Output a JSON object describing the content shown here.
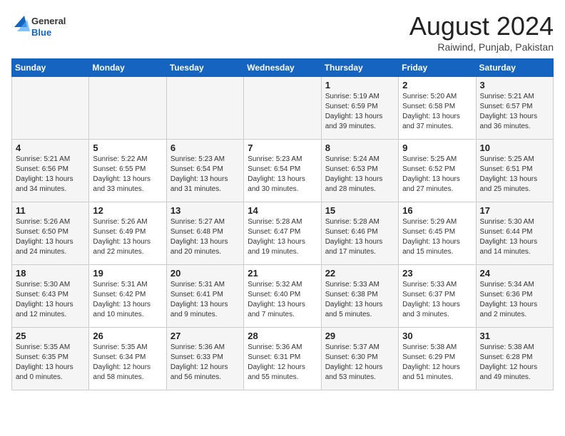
{
  "logo": {
    "general": "General",
    "blue": "Blue"
  },
  "title": "August 2024",
  "location": "Raiwind, Punjab, Pakistan",
  "days_of_week": [
    "Sunday",
    "Monday",
    "Tuesday",
    "Wednesday",
    "Thursday",
    "Friday",
    "Saturday"
  ],
  "weeks": [
    [
      {
        "day": "",
        "content": ""
      },
      {
        "day": "",
        "content": ""
      },
      {
        "day": "",
        "content": ""
      },
      {
        "day": "",
        "content": ""
      },
      {
        "day": "1",
        "content": "Sunrise: 5:19 AM\nSunset: 6:59 PM\nDaylight: 13 hours and 39 minutes."
      },
      {
        "day": "2",
        "content": "Sunrise: 5:20 AM\nSunset: 6:58 PM\nDaylight: 13 hours and 37 minutes."
      },
      {
        "day": "3",
        "content": "Sunrise: 5:21 AM\nSunset: 6:57 PM\nDaylight: 13 hours and 36 minutes."
      }
    ],
    [
      {
        "day": "4",
        "content": "Sunrise: 5:21 AM\nSunset: 6:56 PM\nDaylight: 13 hours and 34 minutes."
      },
      {
        "day": "5",
        "content": "Sunrise: 5:22 AM\nSunset: 6:55 PM\nDaylight: 13 hours and 33 minutes."
      },
      {
        "day": "6",
        "content": "Sunrise: 5:23 AM\nSunset: 6:54 PM\nDaylight: 13 hours and 31 minutes."
      },
      {
        "day": "7",
        "content": "Sunrise: 5:23 AM\nSunset: 6:54 PM\nDaylight: 13 hours and 30 minutes."
      },
      {
        "day": "8",
        "content": "Sunrise: 5:24 AM\nSunset: 6:53 PM\nDaylight: 13 hours and 28 minutes."
      },
      {
        "day": "9",
        "content": "Sunrise: 5:25 AM\nSunset: 6:52 PM\nDaylight: 13 hours and 27 minutes."
      },
      {
        "day": "10",
        "content": "Sunrise: 5:25 AM\nSunset: 6:51 PM\nDaylight: 13 hours and 25 minutes."
      }
    ],
    [
      {
        "day": "11",
        "content": "Sunrise: 5:26 AM\nSunset: 6:50 PM\nDaylight: 13 hours and 24 minutes."
      },
      {
        "day": "12",
        "content": "Sunrise: 5:26 AM\nSunset: 6:49 PM\nDaylight: 13 hours and 22 minutes."
      },
      {
        "day": "13",
        "content": "Sunrise: 5:27 AM\nSunset: 6:48 PM\nDaylight: 13 hours and 20 minutes."
      },
      {
        "day": "14",
        "content": "Sunrise: 5:28 AM\nSunset: 6:47 PM\nDaylight: 13 hours and 19 minutes."
      },
      {
        "day": "15",
        "content": "Sunrise: 5:28 AM\nSunset: 6:46 PM\nDaylight: 13 hours and 17 minutes."
      },
      {
        "day": "16",
        "content": "Sunrise: 5:29 AM\nSunset: 6:45 PM\nDaylight: 13 hours and 15 minutes."
      },
      {
        "day": "17",
        "content": "Sunrise: 5:30 AM\nSunset: 6:44 PM\nDaylight: 13 hours and 14 minutes."
      }
    ],
    [
      {
        "day": "18",
        "content": "Sunrise: 5:30 AM\nSunset: 6:43 PM\nDaylight: 13 hours and 12 minutes."
      },
      {
        "day": "19",
        "content": "Sunrise: 5:31 AM\nSunset: 6:42 PM\nDaylight: 13 hours and 10 minutes."
      },
      {
        "day": "20",
        "content": "Sunrise: 5:31 AM\nSunset: 6:41 PM\nDaylight: 13 hours and 9 minutes."
      },
      {
        "day": "21",
        "content": "Sunrise: 5:32 AM\nSunset: 6:40 PM\nDaylight: 13 hours and 7 minutes."
      },
      {
        "day": "22",
        "content": "Sunrise: 5:33 AM\nSunset: 6:38 PM\nDaylight: 13 hours and 5 minutes."
      },
      {
        "day": "23",
        "content": "Sunrise: 5:33 AM\nSunset: 6:37 PM\nDaylight: 13 hours and 3 minutes."
      },
      {
        "day": "24",
        "content": "Sunrise: 5:34 AM\nSunset: 6:36 PM\nDaylight: 13 hours and 2 minutes."
      }
    ],
    [
      {
        "day": "25",
        "content": "Sunrise: 5:35 AM\nSunset: 6:35 PM\nDaylight: 13 hours and 0 minutes."
      },
      {
        "day": "26",
        "content": "Sunrise: 5:35 AM\nSunset: 6:34 PM\nDaylight: 12 hours and 58 minutes."
      },
      {
        "day": "27",
        "content": "Sunrise: 5:36 AM\nSunset: 6:33 PM\nDaylight: 12 hours and 56 minutes."
      },
      {
        "day": "28",
        "content": "Sunrise: 5:36 AM\nSunset: 6:31 PM\nDaylight: 12 hours and 55 minutes."
      },
      {
        "day": "29",
        "content": "Sunrise: 5:37 AM\nSunset: 6:30 PM\nDaylight: 12 hours and 53 minutes."
      },
      {
        "day": "30",
        "content": "Sunrise: 5:38 AM\nSunset: 6:29 PM\nDaylight: 12 hours and 51 minutes."
      },
      {
        "day": "31",
        "content": "Sunrise: 5:38 AM\nSunset: 6:28 PM\nDaylight: 12 hours and 49 minutes."
      }
    ]
  ]
}
